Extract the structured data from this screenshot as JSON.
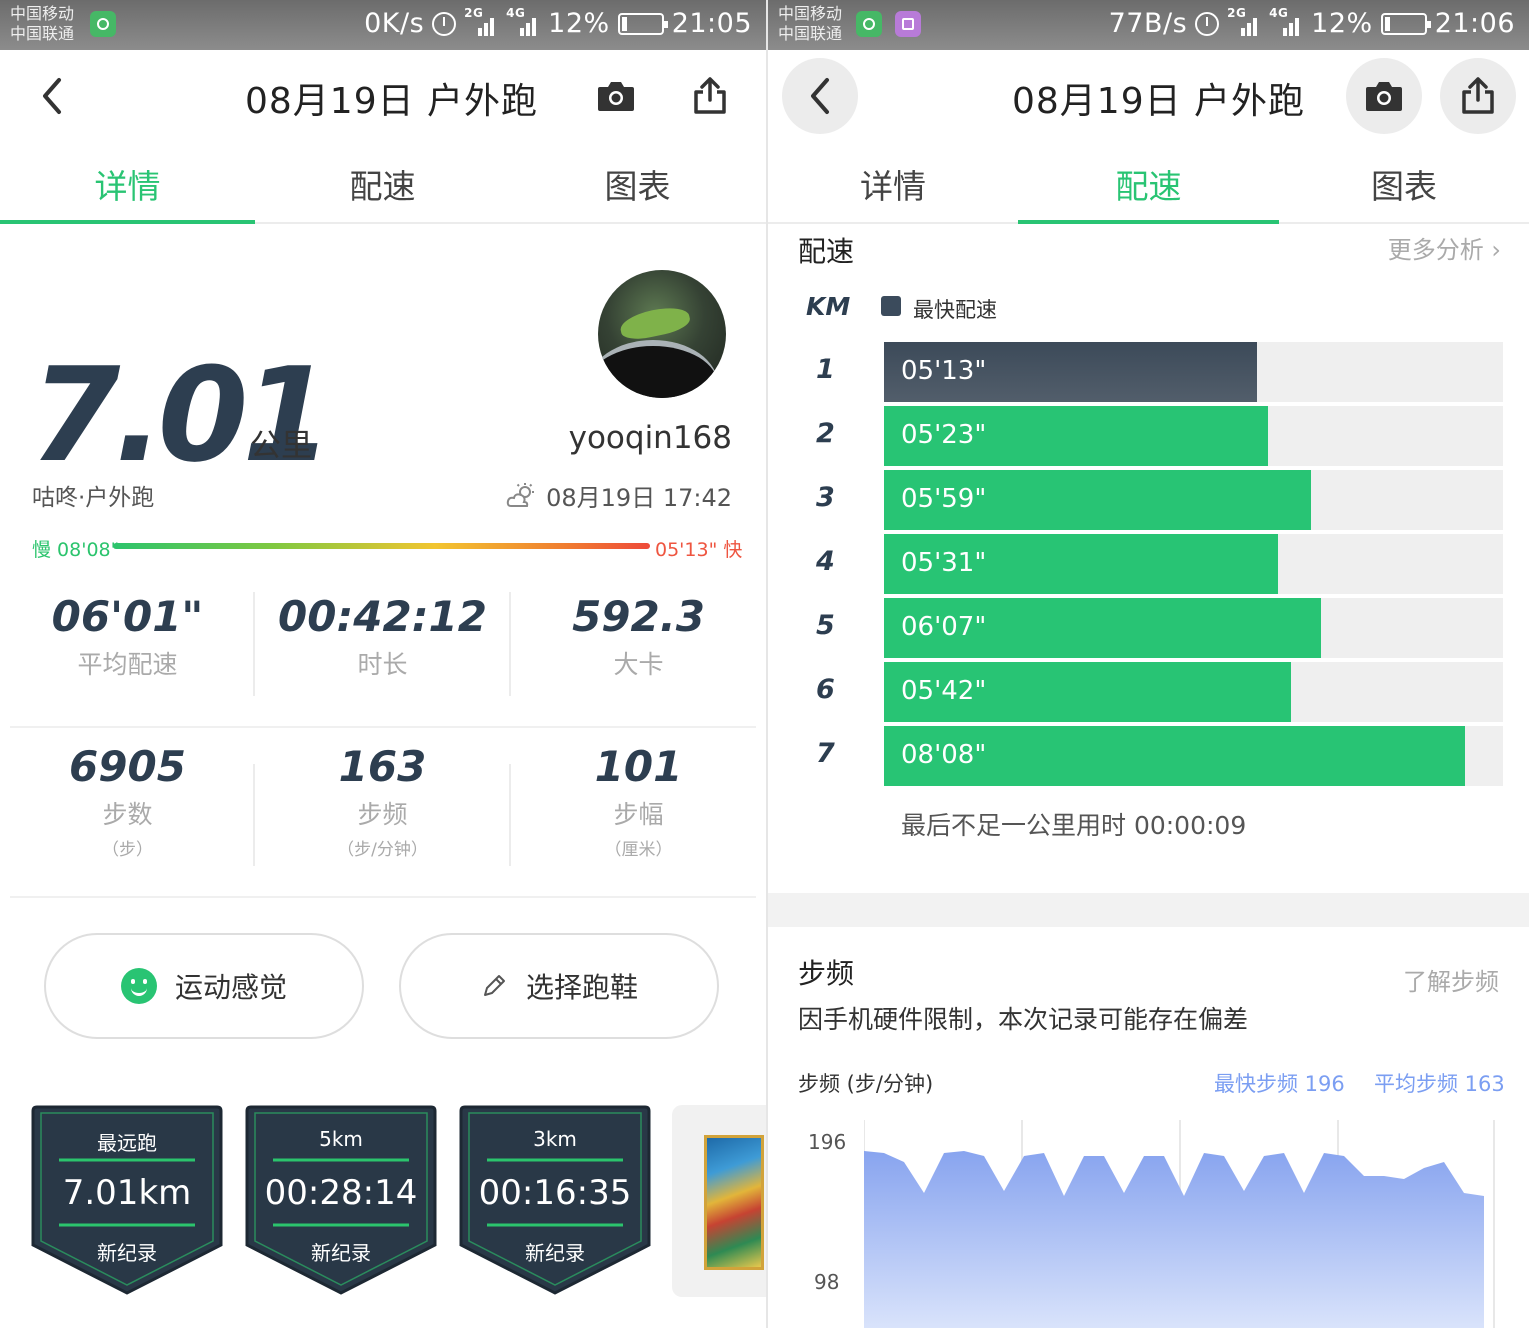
{
  "left": {
    "status": {
      "carrier1": "中国移动",
      "carrier2": "中国联通",
      "speed": "0K/s",
      "battery": "12%",
      "time": "21:05"
    },
    "header": {
      "title": "08月19日 户外跑"
    },
    "tabs": [
      "详情",
      "配速",
      "图表"
    ],
    "active_tab": 0,
    "distance": {
      "value": "7.01",
      "unit": "公里"
    },
    "sport_label": "咕咚·户外跑",
    "username": "yooqin168",
    "datetime": "08月19日 17:42",
    "pace_range": {
      "slow": "慢 08'08\"",
      "fast": "05'13\" 快"
    },
    "stats_row1": [
      {
        "value": "06'01\"",
        "label": "平均配速"
      },
      {
        "value": "00:42:12",
        "label": "时长"
      },
      {
        "value": "592.3",
        "label": "大卡"
      }
    ],
    "stats_row2": [
      {
        "value": "6905",
        "label": "步数",
        "unit": "（步）"
      },
      {
        "value": "163",
        "label": "步频",
        "unit": "（步/分钟）"
      },
      {
        "value": "101",
        "label": "步幅",
        "unit": "（厘米）"
      }
    ],
    "buttons": {
      "feeling": "运动感觉",
      "shoes": "选择跑鞋"
    },
    "badges": [
      {
        "title": "最远跑",
        "value": "7.01km",
        "foot": "新纪录"
      },
      {
        "title": "5km",
        "value": "00:28:14",
        "foot": "新纪录"
      },
      {
        "title": "3km",
        "value": "00:16:35",
        "foot": "新纪录"
      }
    ]
  },
  "right": {
    "status": {
      "carrier1": "中国移动",
      "carrier2": "中国联通",
      "speed": "77B/s",
      "battery": "12%",
      "time": "21:06"
    },
    "header": {
      "title": "08月19日 户外跑"
    },
    "tabs": [
      "详情",
      "配速",
      "图表"
    ],
    "active_tab": 1,
    "pace_section": {
      "title": "配速",
      "more": "更多分析",
      "km_header": "KM",
      "legend": "最快配速",
      "last_note": "最后不足一公里用时 00:00:09"
    },
    "cadence": {
      "title": "步频",
      "learn": "了解步频",
      "note": "因手机硬件限制，本次记录可能存在偏差",
      "axis": "步频  (步/分钟)",
      "fastest": "最快步频 196",
      "average": "平均步频 163",
      "ymax": "196",
      "ymid": "98"
    }
  },
  "colors": {
    "accent": "#29c473",
    "fastest_bar": "#3b4b5c",
    "cadence_fill": "#8ea9f0"
  },
  "chart_data": [
    {
      "type": "bar",
      "title": "配速",
      "categories": [
        "1",
        "2",
        "3",
        "4",
        "5",
        "6",
        "7"
      ],
      "labels": [
        "05'13\"",
        "05'23\"",
        "05'59\"",
        "05'31\"",
        "06'07\"",
        "05'42\"",
        "08'08\""
      ],
      "values_seconds": [
        313,
        323,
        359,
        331,
        367,
        342,
        488
      ],
      "fastest_index": 0
    },
    {
      "type": "area",
      "title": "步频",
      "ylabel": "步频 (步/分钟)",
      "ylim": [
        98,
        196
      ],
      "values": [
        190,
        188,
        182,
        160,
        188,
        190,
        186,
        162,
        186,
        188,
        158,
        186,
        186,
        160,
        186,
        186,
        158,
        188,
        186,
        162,
        186,
        188,
        160,
        188,
        186,
        172,
        172,
        170,
        178,
        182,
        160,
        158
      ]
    }
  ]
}
